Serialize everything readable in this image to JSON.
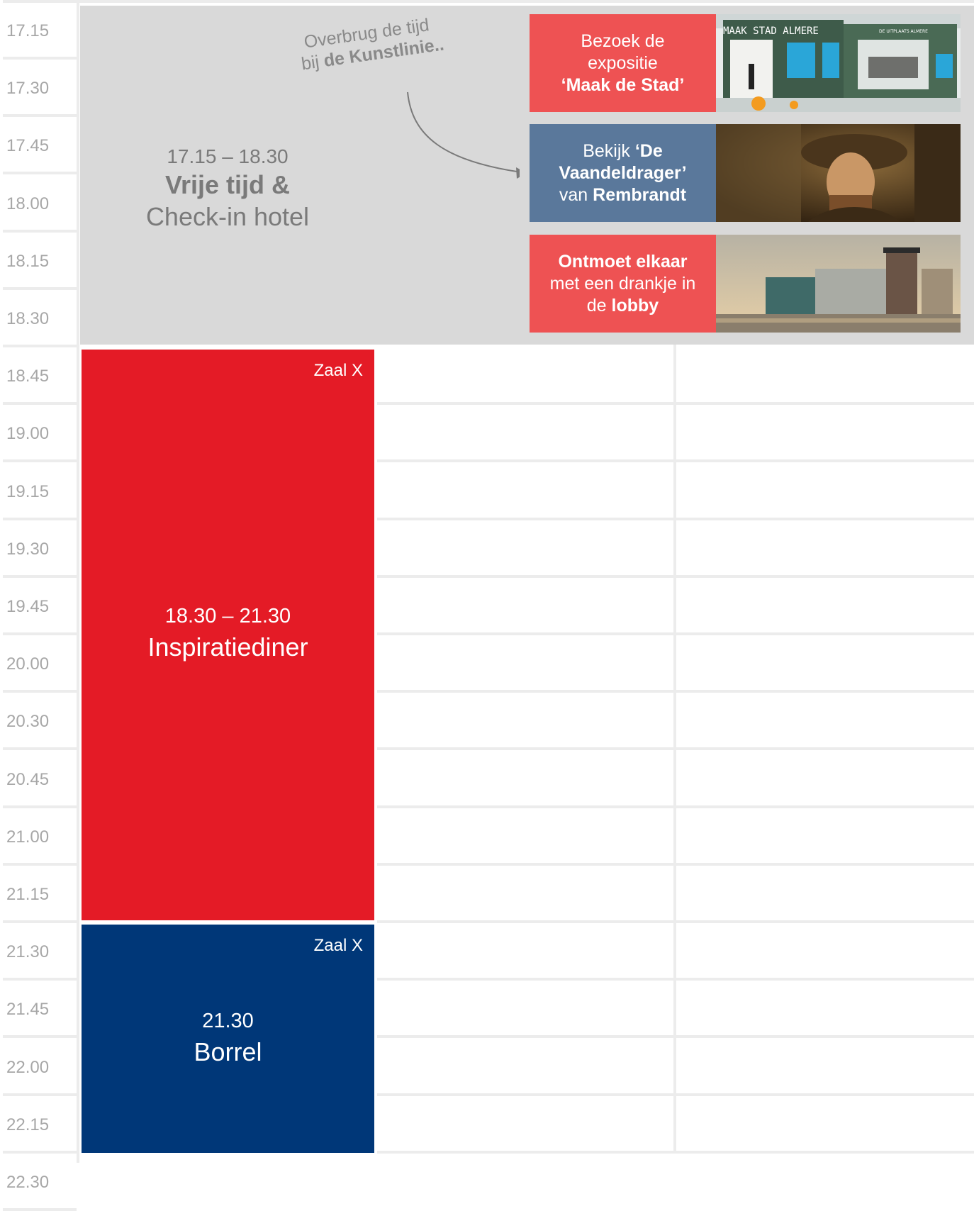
{
  "time_labels": [
    "17.15",
    "17.30",
    "17.45",
    "18.00",
    "18.15",
    "18.30",
    "18.45",
    "19.00",
    "19.15",
    "19.30",
    "19.45",
    "20.00",
    "20.30",
    "20.45",
    "21.00",
    "21.15",
    "21.30",
    "21.45",
    "22.00",
    "22.15",
    "22.30"
  ],
  "free_block": {
    "time": "17.15 – 18.30",
    "title_line1": "Vrije tijd &",
    "title_line2": "Check-in hotel",
    "hint_line1": "Overbrug de tijd",
    "hint_line2_pre": "bij ",
    "hint_line2_bold": "de Kunstlinie..",
    "colors": {
      "background": "#d9d9d9",
      "text": "#7a7a7a"
    }
  },
  "cards": [
    {
      "line1": "Bezoek de",
      "line2": "expositie",
      "line3_bold": "‘Maak de Stad’",
      "image_text": "MAAK  STAD  ALMERE",
      "image_subtext": "DE UITPLAATS ALMERE",
      "color": "#ee5253"
    },
    {
      "line1_pre": "Bekijk ",
      "line1_bold": "‘De",
      "line2_bold": "Vaandeldrager’",
      "line3_pre": "van ",
      "line3_bold": "Rembrandt",
      "color": "#5a789b"
    },
    {
      "line1_bold": "Ontmoet elkaar",
      "line2": "met een drankje in",
      "line3_pre": "de ",
      "line3_bold": "lobby",
      "color": "#ee5253"
    }
  ],
  "dinner_block": {
    "room": "Zaal X",
    "time": "18.30 – 21.30",
    "title": "Inspiratiediner",
    "color": "#e41b26"
  },
  "drinks_block": {
    "room": "Zaal X",
    "time": "21.30",
    "title": "Borrel",
    "color": "#003778"
  }
}
